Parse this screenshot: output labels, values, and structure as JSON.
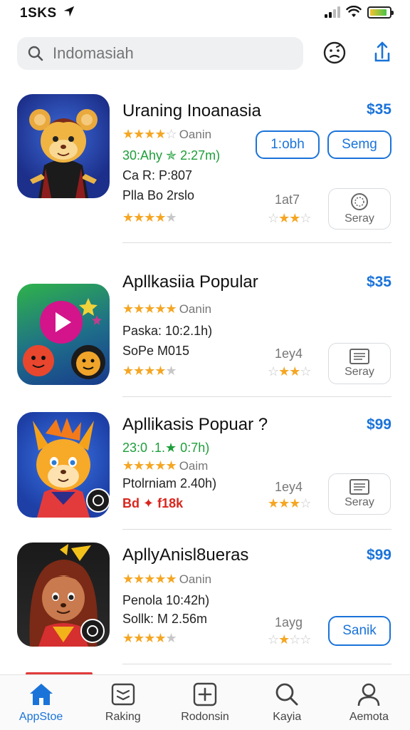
{
  "status": {
    "time": "1SKS"
  },
  "search": {
    "placeholder": "Indomasiah",
    "value": ""
  },
  "apps": [
    {
      "title": "Uraning Inoanasia",
      "price": "$35",
      "rating_label": "Oanin",
      "line1": "30:Ahy ✯ 2:27m)",
      "line1_color": "#1e9e3a",
      "line2": "Ca R: P:807",
      "line3": "Plla Bo 2rslo",
      "mini_count": "1at7",
      "button_a": "1:obh",
      "button_b": "Semg",
      "card_label": "Seray"
    },
    {
      "title": "Apllkasiia Popular",
      "price": "$35",
      "rating_label": "Oanin",
      "line1": "Paska: 10:2.1h)",
      "line1_color": "#222222",
      "line2": "SoPe M015",
      "mini_count": "1ey4",
      "card_label": "Seray"
    },
    {
      "title": "Apllikasis Popuar ?",
      "price": "$99",
      "line1": "23:0 .1.★ 0:7h)",
      "line1_color": "#1e9e3a",
      "rating_label": "Oaim",
      "line2": "Ptolrniam 2.40h)",
      "line3": "Bd ✦ f18k",
      "mini_count": "1ey4",
      "card_label": "Seray"
    },
    {
      "title": "ApllyAnisl8ueras",
      "price": "$99",
      "rating_label": "Oanin",
      "line1": "Penola 10:42h)",
      "line1_color": "#222222",
      "line2": "Sollk: M 2.56m",
      "mini_count": "1ayg",
      "button_a": "Sanik"
    }
  ],
  "tabs": [
    {
      "label": "AppStoe",
      "icon": "home-icon"
    },
    {
      "label": "Raking",
      "icon": "ranking-icon"
    },
    {
      "label": "Rodonsin",
      "icon": "plus-square-icon"
    },
    {
      "label": "Kayia",
      "icon": "search-icon"
    },
    {
      "label": "Aemota",
      "icon": "person-icon"
    }
  ],
  "colors": {
    "accent": "#1a73d9",
    "star": "#f5a623",
    "green": "#1e9e3a"
  }
}
